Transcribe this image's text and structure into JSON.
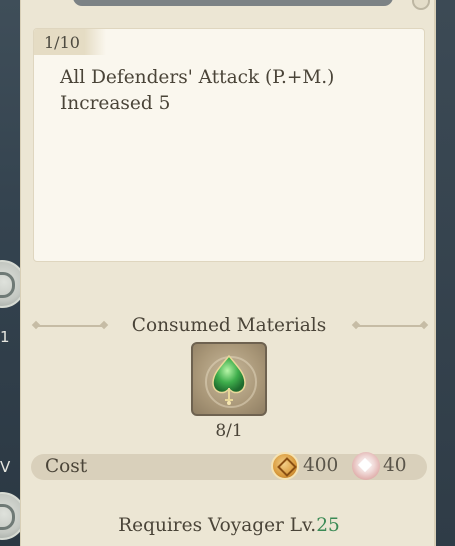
{
  "description": {
    "level": "1/10",
    "text": "All Defenders' Attack (P.+M.) Increased 5"
  },
  "materials": {
    "title": "Consumed Materials",
    "item": {
      "icon": "green-leaf-gem-icon",
      "count": "8/1"
    }
  },
  "cost": {
    "label": "Cost",
    "gold": {
      "icon": "gold-coin-icon",
      "value": "400"
    },
    "special": {
      "icon": "pink-diamond-currency-icon",
      "value": "40"
    }
  },
  "requirement": {
    "prefix": "Requires Voyager Lv.",
    "level": "25",
    "level_color": "#3a8a55"
  },
  "sidebar": {
    "upper_label": "1",
    "lower_label": "V"
  }
}
